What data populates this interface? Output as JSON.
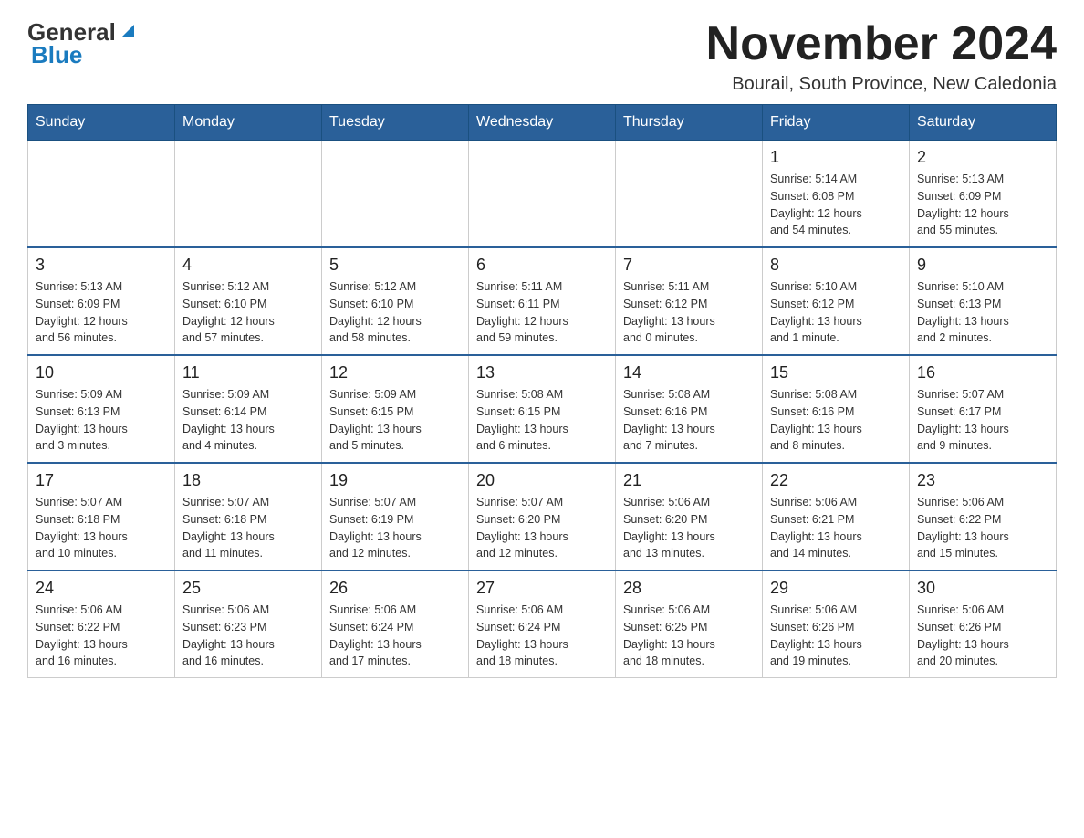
{
  "header": {
    "logo_general": "General",
    "logo_blue": "Blue",
    "month_title": "November 2024",
    "location": "Bourail, South Province, New Caledonia"
  },
  "weekdays": [
    "Sunday",
    "Monday",
    "Tuesday",
    "Wednesday",
    "Thursday",
    "Friday",
    "Saturday"
  ],
  "weeks": [
    {
      "days": [
        {
          "number": "",
          "info": ""
        },
        {
          "number": "",
          "info": ""
        },
        {
          "number": "",
          "info": ""
        },
        {
          "number": "",
          "info": ""
        },
        {
          "number": "",
          "info": ""
        },
        {
          "number": "1",
          "info": "Sunrise: 5:14 AM\nSunset: 6:08 PM\nDaylight: 12 hours\nand 54 minutes."
        },
        {
          "number": "2",
          "info": "Sunrise: 5:13 AM\nSunset: 6:09 PM\nDaylight: 12 hours\nand 55 minutes."
        }
      ]
    },
    {
      "days": [
        {
          "number": "3",
          "info": "Sunrise: 5:13 AM\nSunset: 6:09 PM\nDaylight: 12 hours\nand 56 minutes."
        },
        {
          "number": "4",
          "info": "Sunrise: 5:12 AM\nSunset: 6:10 PM\nDaylight: 12 hours\nand 57 minutes."
        },
        {
          "number": "5",
          "info": "Sunrise: 5:12 AM\nSunset: 6:10 PM\nDaylight: 12 hours\nand 58 minutes."
        },
        {
          "number": "6",
          "info": "Sunrise: 5:11 AM\nSunset: 6:11 PM\nDaylight: 12 hours\nand 59 minutes."
        },
        {
          "number": "7",
          "info": "Sunrise: 5:11 AM\nSunset: 6:12 PM\nDaylight: 13 hours\nand 0 minutes."
        },
        {
          "number": "8",
          "info": "Sunrise: 5:10 AM\nSunset: 6:12 PM\nDaylight: 13 hours\nand 1 minute."
        },
        {
          "number": "9",
          "info": "Sunrise: 5:10 AM\nSunset: 6:13 PM\nDaylight: 13 hours\nand 2 minutes."
        }
      ]
    },
    {
      "days": [
        {
          "number": "10",
          "info": "Sunrise: 5:09 AM\nSunset: 6:13 PM\nDaylight: 13 hours\nand 3 minutes."
        },
        {
          "number": "11",
          "info": "Sunrise: 5:09 AM\nSunset: 6:14 PM\nDaylight: 13 hours\nand 4 minutes."
        },
        {
          "number": "12",
          "info": "Sunrise: 5:09 AM\nSunset: 6:15 PM\nDaylight: 13 hours\nand 5 minutes."
        },
        {
          "number": "13",
          "info": "Sunrise: 5:08 AM\nSunset: 6:15 PM\nDaylight: 13 hours\nand 6 minutes."
        },
        {
          "number": "14",
          "info": "Sunrise: 5:08 AM\nSunset: 6:16 PM\nDaylight: 13 hours\nand 7 minutes."
        },
        {
          "number": "15",
          "info": "Sunrise: 5:08 AM\nSunset: 6:16 PM\nDaylight: 13 hours\nand 8 minutes."
        },
        {
          "number": "16",
          "info": "Sunrise: 5:07 AM\nSunset: 6:17 PM\nDaylight: 13 hours\nand 9 minutes."
        }
      ]
    },
    {
      "days": [
        {
          "number": "17",
          "info": "Sunrise: 5:07 AM\nSunset: 6:18 PM\nDaylight: 13 hours\nand 10 minutes."
        },
        {
          "number": "18",
          "info": "Sunrise: 5:07 AM\nSunset: 6:18 PM\nDaylight: 13 hours\nand 11 minutes."
        },
        {
          "number": "19",
          "info": "Sunrise: 5:07 AM\nSunset: 6:19 PM\nDaylight: 13 hours\nand 12 minutes."
        },
        {
          "number": "20",
          "info": "Sunrise: 5:07 AM\nSunset: 6:20 PM\nDaylight: 13 hours\nand 12 minutes."
        },
        {
          "number": "21",
          "info": "Sunrise: 5:06 AM\nSunset: 6:20 PM\nDaylight: 13 hours\nand 13 minutes."
        },
        {
          "number": "22",
          "info": "Sunrise: 5:06 AM\nSunset: 6:21 PM\nDaylight: 13 hours\nand 14 minutes."
        },
        {
          "number": "23",
          "info": "Sunrise: 5:06 AM\nSunset: 6:22 PM\nDaylight: 13 hours\nand 15 minutes."
        }
      ]
    },
    {
      "days": [
        {
          "number": "24",
          "info": "Sunrise: 5:06 AM\nSunset: 6:22 PM\nDaylight: 13 hours\nand 16 minutes."
        },
        {
          "number": "25",
          "info": "Sunrise: 5:06 AM\nSunset: 6:23 PM\nDaylight: 13 hours\nand 16 minutes."
        },
        {
          "number": "26",
          "info": "Sunrise: 5:06 AM\nSunset: 6:24 PM\nDaylight: 13 hours\nand 17 minutes."
        },
        {
          "number": "27",
          "info": "Sunrise: 5:06 AM\nSunset: 6:24 PM\nDaylight: 13 hours\nand 18 minutes."
        },
        {
          "number": "28",
          "info": "Sunrise: 5:06 AM\nSunset: 6:25 PM\nDaylight: 13 hours\nand 18 minutes."
        },
        {
          "number": "29",
          "info": "Sunrise: 5:06 AM\nSunset: 6:26 PM\nDaylight: 13 hours\nand 19 minutes."
        },
        {
          "number": "30",
          "info": "Sunrise: 5:06 AM\nSunset: 6:26 PM\nDaylight: 13 hours\nand 20 minutes."
        }
      ]
    }
  ]
}
